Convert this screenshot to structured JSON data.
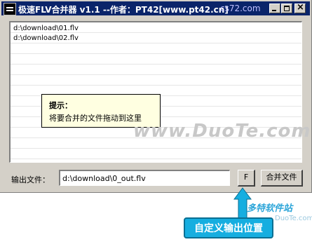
{
  "window": {
    "title": "极速FLV合并器 v1.1 --作者：PT42[www.pt42.cn]",
    "title_watermark": "cs72.com",
    "accent_color": "#0a246a"
  },
  "file_list": {
    "items": [
      "d:\\download\\01.flv",
      "d:\\download\\02.flv"
    ]
  },
  "tooltip": {
    "title": "提示：",
    "body": "将要合并的文件拖动到这里"
  },
  "watermark_text": "www.DuoTe.com",
  "output": {
    "label": "输出文件：",
    "value": "d:\\download\\0_out.flv"
  },
  "buttons": {
    "browse_label": "F",
    "merge_label": "合并文件"
  },
  "annotation": {
    "callout_text": "自定义输出位置",
    "logo_text": "多特软件站",
    "logo_sub": "DuoTe.com"
  }
}
